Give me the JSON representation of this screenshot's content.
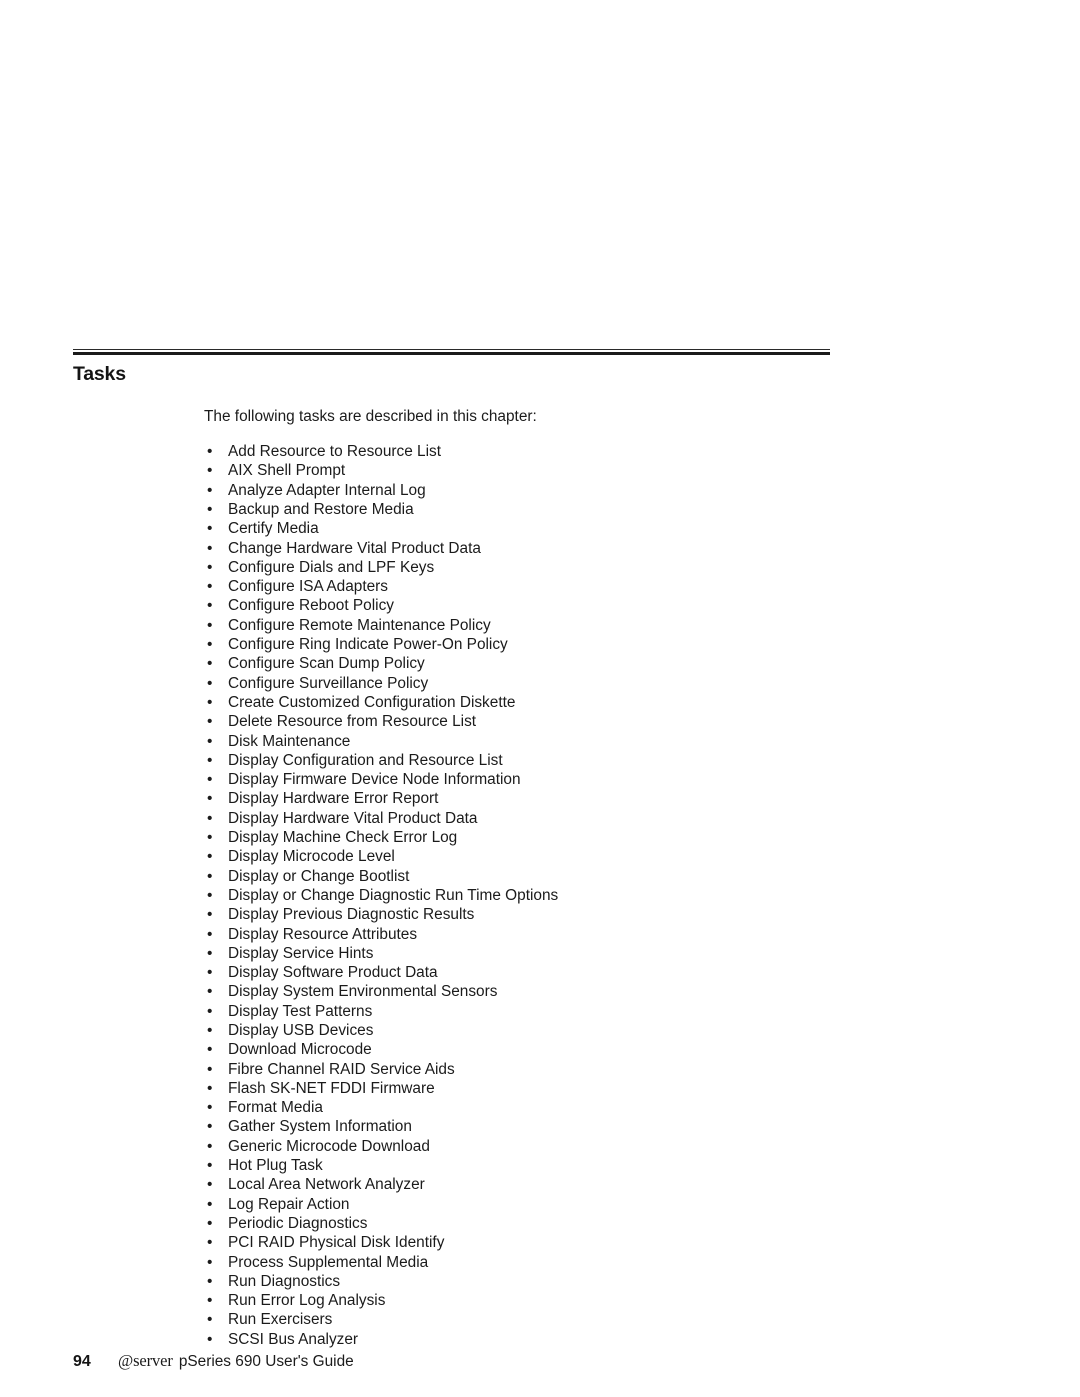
{
  "section": {
    "title": "Tasks",
    "intro": "The following tasks are described in this chapter:",
    "bullet_glyph": "•"
  },
  "tasks": [
    "Add Resource to Resource List",
    "AIX Shell Prompt",
    "Analyze Adapter Internal Log",
    "Backup and Restore Media",
    "Certify Media",
    "Change Hardware Vital Product Data",
    "Configure Dials and LPF Keys",
    "Configure ISA Adapters",
    "Configure Reboot Policy",
    "Configure Remote Maintenance Policy",
    "Configure Ring Indicate Power-On Policy",
    "Configure Scan Dump Policy",
    "Configure Surveillance Policy",
    "Create Customized Configuration Diskette",
    "Delete Resource from Resource List",
    "Disk Maintenance",
    "Display Configuration and Resource List",
    "Display Firmware Device Node Information",
    "Display Hardware Error Report",
    "Display Hardware Vital Product Data",
    "Display Machine Check Error Log",
    "Display Microcode Level",
    "Display or Change Bootlist",
    "Display or Change Diagnostic Run Time Options",
    "Display Previous Diagnostic Results",
    "Display Resource Attributes",
    "Display Service Hints",
    "Display Software Product Data",
    "Display System Environmental Sensors",
    "Display Test Patterns",
    "Display USB Devices",
    "Download Microcode",
    "Fibre Channel RAID Service Aids",
    "Flash SK-NET FDDI Firmware",
    "Format Media",
    "Gather System Information",
    "Generic Microcode Download",
    "Hot Plug Task",
    "Local Area Network Analyzer",
    "Log Repair Action",
    "Periodic Diagnostics",
    "PCI RAID Physical Disk Identify",
    "Process Supplemental Media",
    "Run Diagnostics",
    "Run Error Log Analysis",
    "Run Exercisers",
    "SCSI Bus Analyzer"
  ],
  "footer": {
    "page_number": "94",
    "brand": "@server",
    "book_title": "pSeries 690 User's Guide"
  },
  "colors": {
    "text": "#1b1b1b",
    "rule": "#1b1b1b",
    "background": "#ffffff"
  }
}
